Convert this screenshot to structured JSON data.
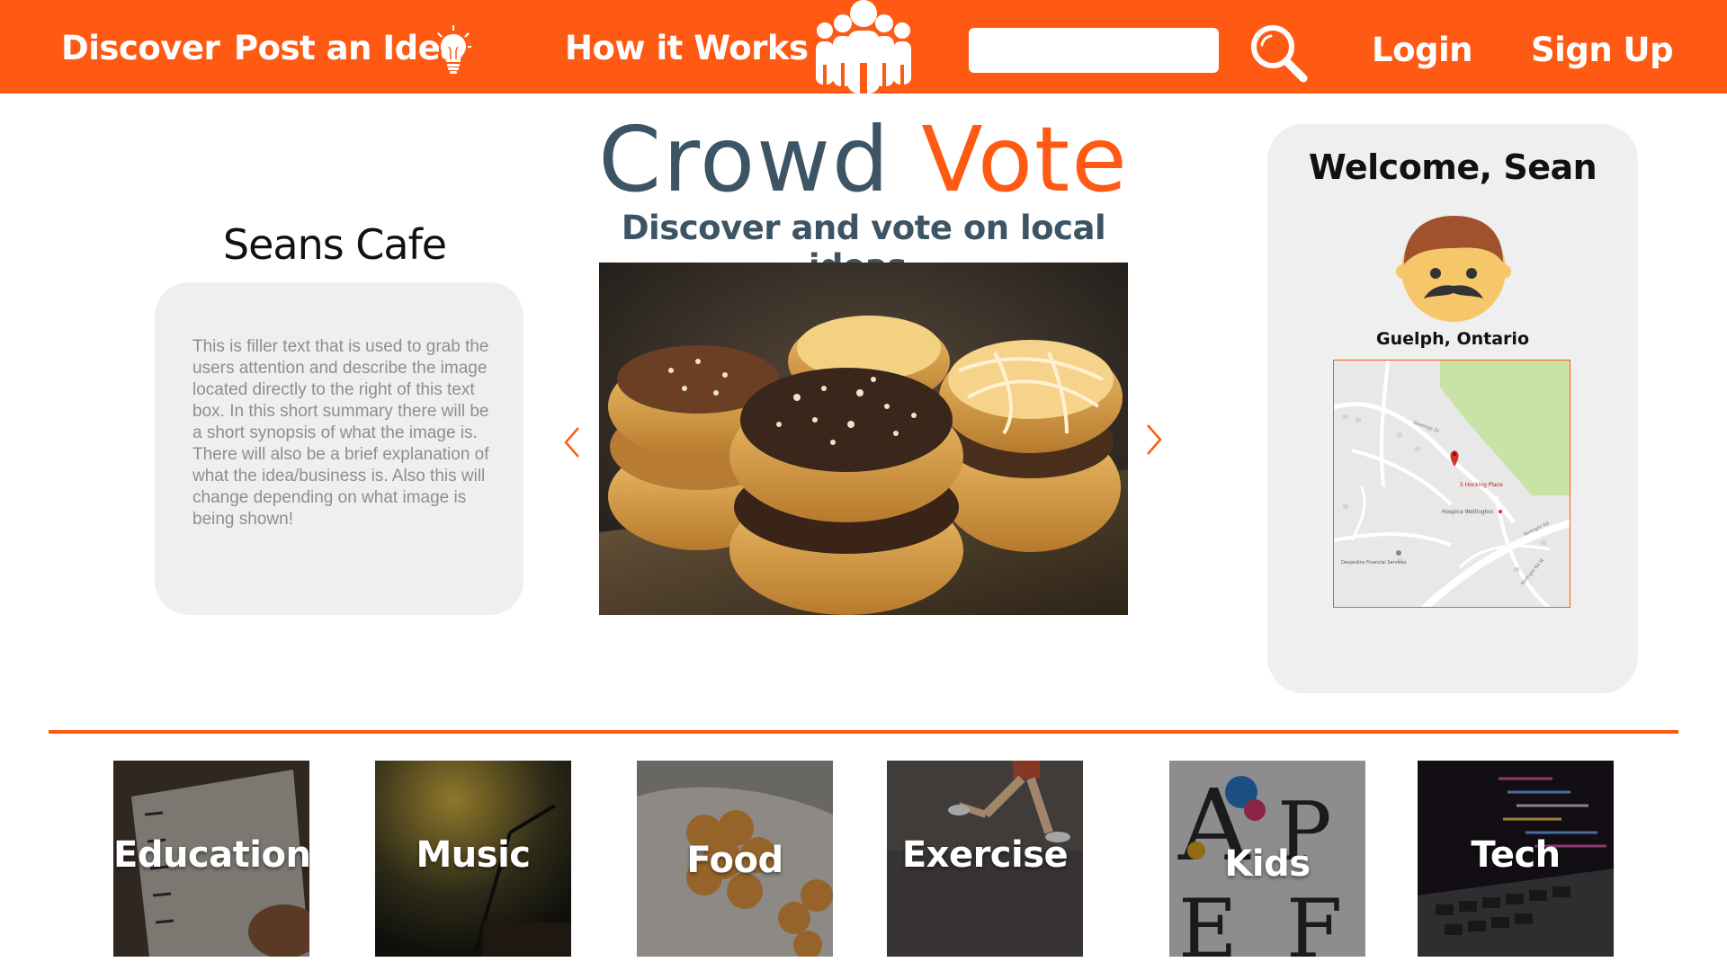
{
  "header": {
    "nav": {
      "discover": "Discover",
      "post_idea": "Post an Idea",
      "how_it_works": "How it Works",
      "login": "Login",
      "signup": "Sign Up"
    },
    "search": {
      "value": "",
      "placeholder": ""
    },
    "icons": [
      "lightbulb-icon",
      "crowd-logo-icon",
      "search-icon"
    ]
  },
  "hero": {
    "brand_part1": "Crowd",
    "brand_part2": "Vote",
    "tagline": "Discover and vote on local ideas.",
    "image": "donuts-photo"
  },
  "featured": {
    "title": "Seans Cafe",
    "description": "This is filler text that is used to grab the users attention and describe the image located directly to the right of this text box. In this short summary there will be a short synopsis of what the image is. There will also be a brief explanation of what the idea/business is. Also this will change depending on what image is being shown!"
  },
  "profile": {
    "welcome": "Welcome, Sean",
    "location": "Guelph, Ontario",
    "avatar": "avatar-man-mustache",
    "map": {
      "labels": [
        "5 Hocking Place",
        "Hospice Wellington",
        "Gowlings Dr",
        "Kortright Rd W",
        "Kortright Rd",
        "Desjardins Financial Services"
      ]
    }
  },
  "categories": [
    {
      "label": "Education"
    },
    {
      "label": "Music"
    },
    {
      "label": "Food"
    },
    {
      "label": "Exercise"
    },
    {
      "label": "Kids"
    },
    {
      "label": "Tech"
    }
  ],
  "colors": {
    "accent": "#ff5a14",
    "brand_dark": "#3d5465",
    "card_bg": "#efefef"
  }
}
